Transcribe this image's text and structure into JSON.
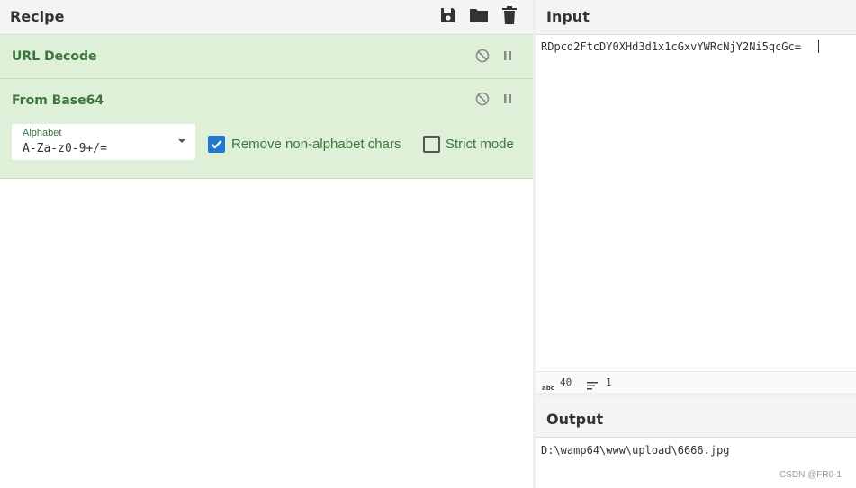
{
  "recipe": {
    "title": "Recipe",
    "icons": [
      "save-icon",
      "folder-icon",
      "trash-icon"
    ],
    "operations": [
      {
        "name": "URL Decode",
        "controls": [
          "disable-icon",
          "pause-icon"
        ]
      },
      {
        "name": "From Base64",
        "controls": [
          "disable-icon",
          "pause-icon"
        ],
        "alphabet_label": "Alphabet",
        "alphabet_value": "A-Za-z0-9+/=",
        "remove_label": "Remove non-alphabet chars",
        "remove_checked": true,
        "strict_label": "Strict mode",
        "strict_checked": false
      }
    ]
  },
  "input": {
    "title": "Input",
    "value": "RDpcd2FtcDY0XHd3d1x1cGxvYWRcNjY2Ni5qcGc=",
    "length_icon": "abc-icon",
    "length": "40",
    "lines_icon": "lines-icon",
    "lines": "1"
  },
  "output": {
    "title": "Output",
    "value": "D:\\wamp64\\www\\upload\\6666.jpg"
  },
  "watermark": "CSDN @FR0-1",
  "colors": {
    "op_bg": "#dff0d8",
    "op_text": "#3c763d",
    "checkbox": "#1f78d1"
  }
}
